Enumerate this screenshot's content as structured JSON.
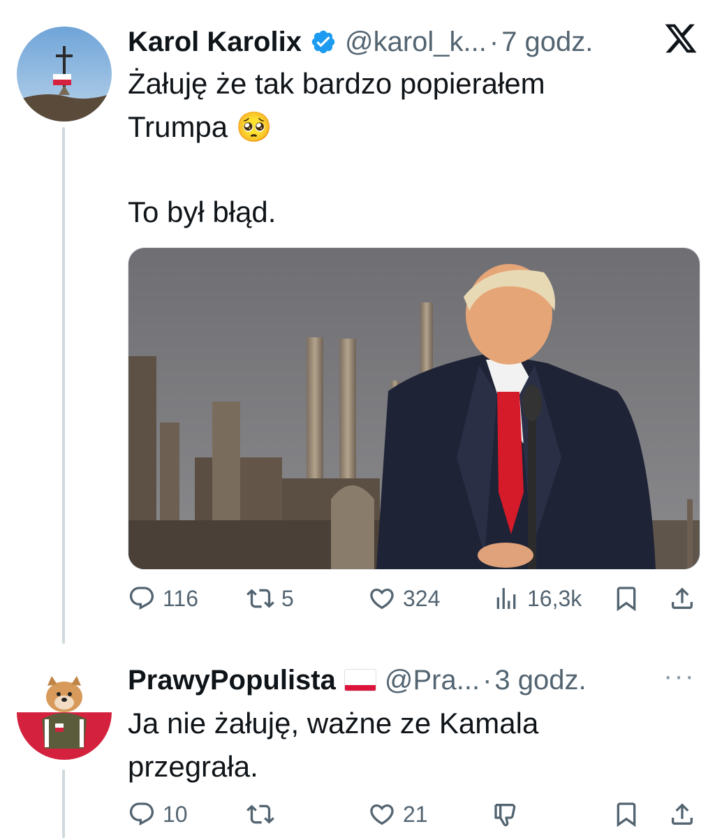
{
  "tweet1": {
    "name": "Karol Karolix",
    "handle": "@karol_k...",
    "separator": "·",
    "time": "7 godz.",
    "text_line1": "Żałuję że tak bardzo popierałem",
    "text_line2": "Trumpa 🥺",
    "text_line3": "To był błąd.",
    "actions": {
      "replies": "116",
      "reposts": "5",
      "likes": "324",
      "views": "16,3k"
    }
  },
  "tweet2": {
    "name": "PrawyPopulista",
    "handle": "@Pra...",
    "separator": "·",
    "time": "3 godz.",
    "text_line1": "Ja nie żałuję, ważne ze Kamala",
    "text_line2": "przegrała.",
    "actions": {
      "replies": "10",
      "reposts": "",
      "likes": "21"
    },
    "more_label": "···"
  },
  "icons": {
    "reply": "reply-icon",
    "repost": "repost-icon",
    "like": "heart-icon",
    "views": "views-icon",
    "bookmark": "bookmark-icon",
    "share": "share-icon",
    "dislike": "thumbs-down-icon",
    "brand": "x-logo-icon",
    "verified": "verified-badge-icon"
  },
  "colors": {
    "text": "#0f1419",
    "muted": "#536471",
    "verified": "#1d9bf0",
    "thread_line": "#cfd9de"
  }
}
